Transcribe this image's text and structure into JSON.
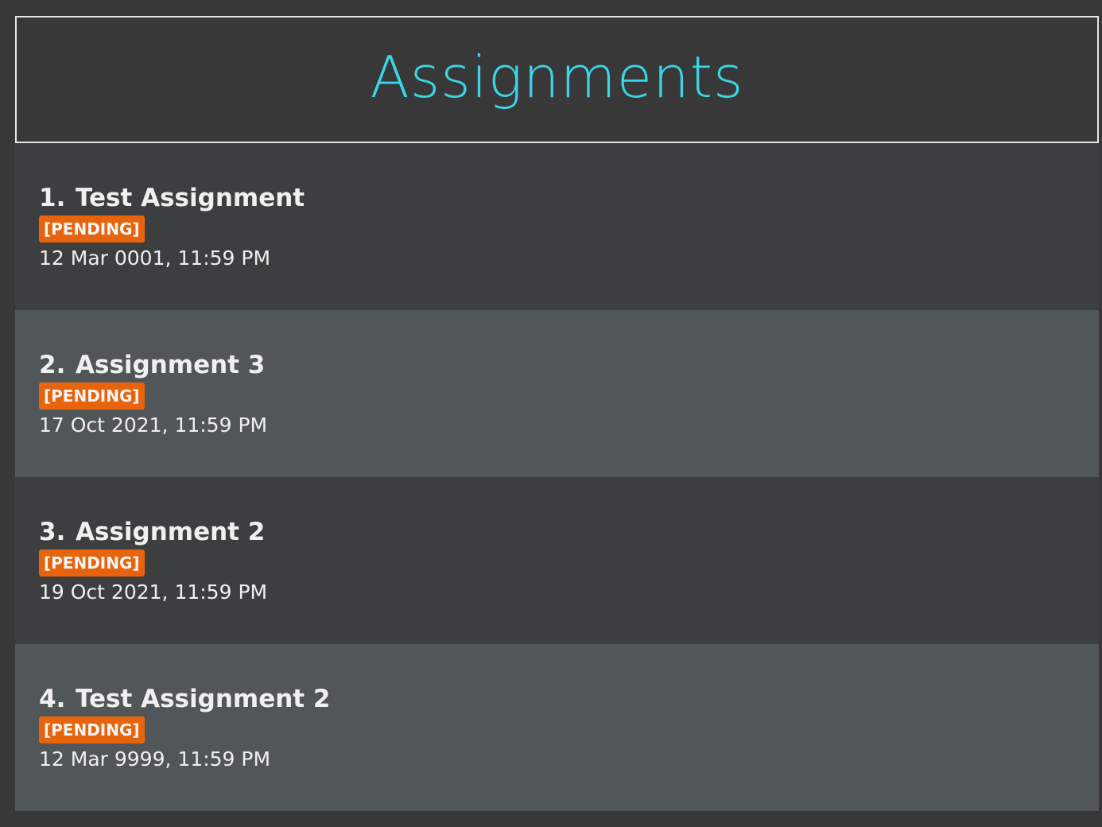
{
  "header": {
    "title": "Assignments"
  },
  "assignments": [
    {
      "index": "1.",
      "name": "Test Assignment",
      "status": "[PENDING]",
      "due": "12 Mar 0001, 11:59 PM"
    },
    {
      "index": "2.",
      "name": "Assignment 3",
      "status": "[PENDING]",
      "due": "17 Oct 2021, 11:59 PM"
    },
    {
      "index": "3.",
      "name": "Assignment 2",
      "status": "[PENDING]",
      "due": "19 Oct 2021, 11:59 PM"
    },
    {
      "index": "4.",
      "name": "Test Assignment 2",
      "status": "[PENDING]",
      "due": "12 Mar 9999, 11:59 PM"
    }
  ],
  "colors": {
    "title": "#3ad5e6",
    "pending_badge": "#e8640c",
    "row_odd": "#3d3e40",
    "row_even": "#515658",
    "background": "#383838"
  }
}
